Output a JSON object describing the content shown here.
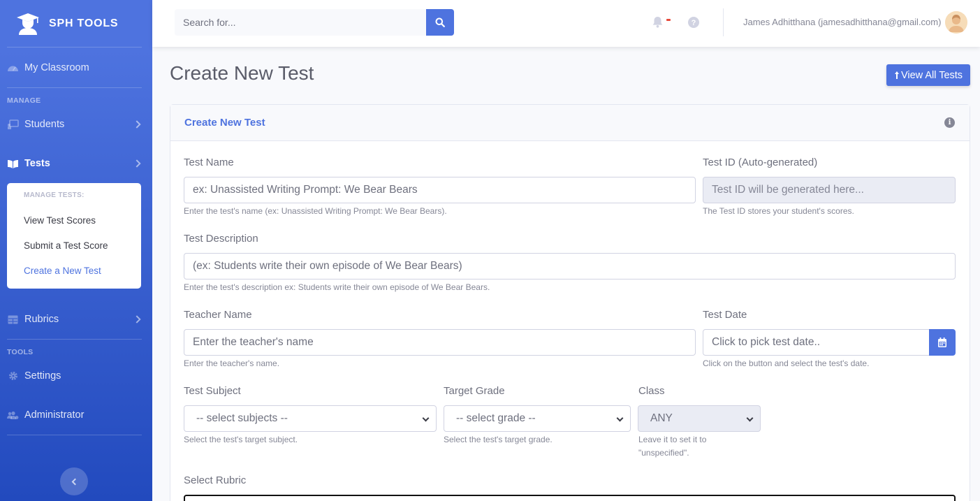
{
  "brand": {
    "name": "SPH TOOLS"
  },
  "sidebar": {
    "my_classroom": "My Classroom",
    "heading_manage": "MANAGE",
    "students": "Students",
    "tests": "Tests",
    "submenu_heading": "MANAGE TESTS:",
    "submenu_items": [
      "View Test Scores",
      "Submit a Test Score",
      "Create a New Test"
    ],
    "rubrics": "Rubrics",
    "heading_tools": "TOOLS",
    "settings": "Settings",
    "administrator": "Administrator"
  },
  "topbar": {
    "search_placeholder": "Search for...",
    "user": "James Adhitthana (jamesadhitthana@gmail.com)"
  },
  "page": {
    "title": "Create New Test",
    "view_all_button": "View All Tests"
  },
  "card": {
    "title": "Create New Test",
    "test_name": {
      "label": "Test Name",
      "placeholder": "ex: Unassisted Writing Prompt: We Bear Bears",
      "help": "Enter the test's name (ex: Unassisted Writing Prompt: We Bear Bears)."
    },
    "test_id": {
      "label": "Test ID (Auto-generated)",
      "placeholder": "Test ID will be generated here...",
      "help": "The Test ID stores your student's scores."
    },
    "test_description": {
      "label": "Test Description",
      "placeholder": "(ex: Students write their own episode of We Bear Bears)",
      "help": "Enter the test's description ex: Students write their own episode of We Bear Bears."
    },
    "teacher_name": {
      "label": "Teacher Name",
      "placeholder": "Enter the teacher's name",
      "help": "Enter the teacher's name."
    },
    "test_date": {
      "label": "Test Date",
      "placeholder": "Click to pick test date..",
      "help": "Click on the button and select the test's date."
    },
    "test_subject": {
      "label": "Test Subject",
      "value": "-- select subjects --",
      "help": "Select the test's target subject."
    },
    "target_grade": {
      "label": "Target Grade",
      "value": "-- select grade --",
      "help": "Select the test's target grade."
    },
    "class": {
      "label": "Class",
      "value": "ANY",
      "help_line1": "Leave it to set it to",
      "help_line2": "\"unspecified\"."
    },
    "select_rubric": {
      "label": "Select Rubric"
    }
  },
  "colors": {
    "primary": "#4e73df",
    "sidebar_dark": "#224abe",
    "danger": "#e74a3b"
  },
  "icons": [
    "user-graduate-icon",
    "tachometer-icon",
    "chalkboard-icon",
    "book-open-icon",
    "table-icon",
    "cog-icon",
    "users-cog-icon",
    "search-icon",
    "bell-icon",
    "question-circle-icon",
    "info-icon",
    "calendar-icon",
    "arrow-up-icon",
    "chevron-right-icon",
    "chevron-left-icon",
    "chevron-down-icon"
  ]
}
